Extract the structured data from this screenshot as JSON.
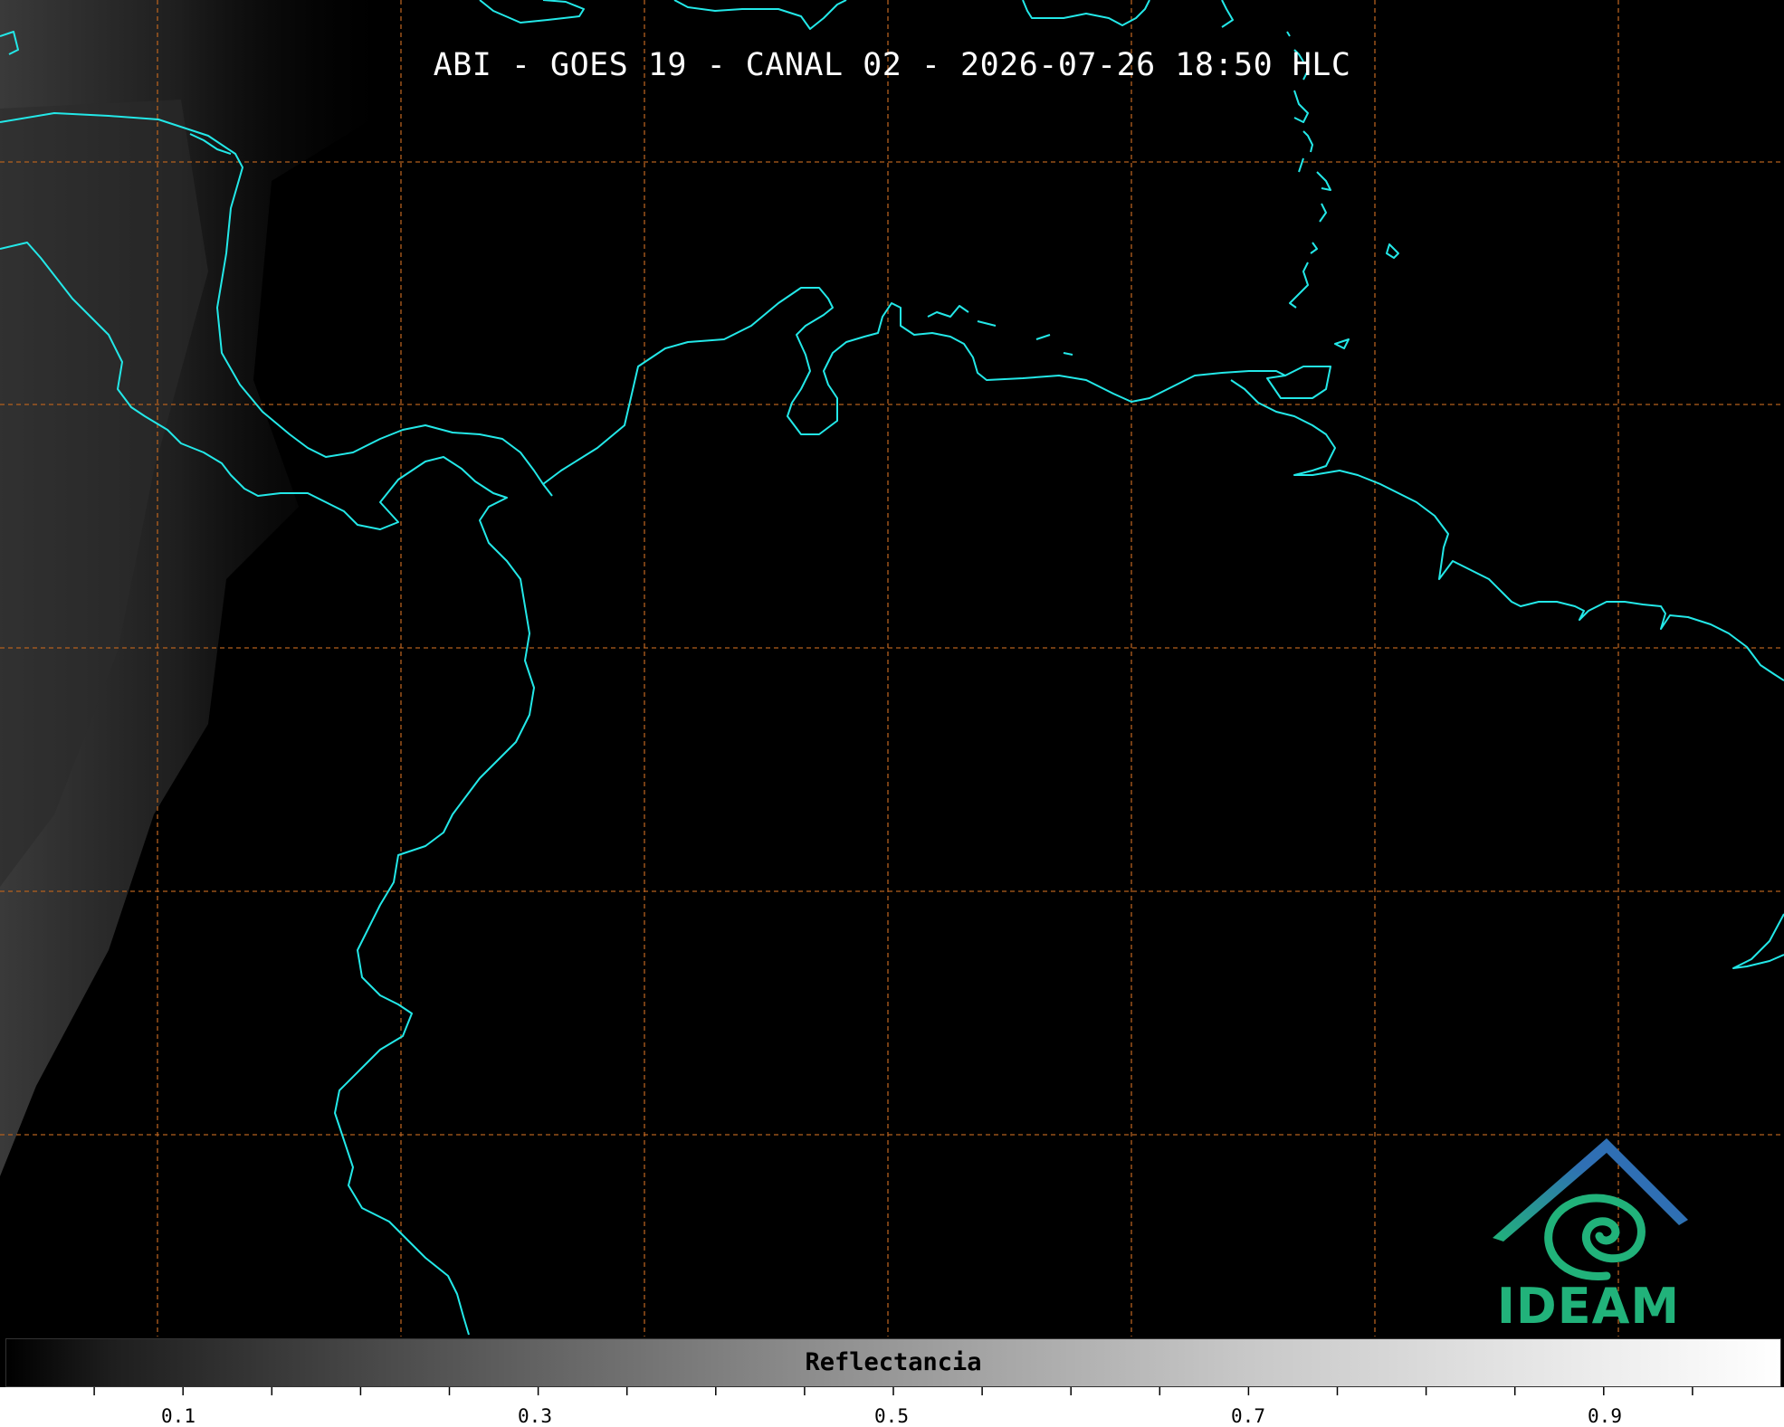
{
  "title": "ABI - GOES 19 - CANAL 02 - 2026-07-26 18:50 HLC",
  "colorbar": {
    "label": "Reflectancia",
    "min": 0.0,
    "max": 1.0,
    "tick_labels": [
      "0.1",
      "0.3",
      "0.5",
      "0.7",
      "0.9"
    ]
  },
  "logo": {
    "text": "IDEAM"
  },
  "colors": {
    "coastline": "#23e8e8",
    "gridline": "#b4601e",
    "background": "#000000",
    "logo_green": "#21b27a",
    "logo_blue": "#2f6fb4"
  }
}
